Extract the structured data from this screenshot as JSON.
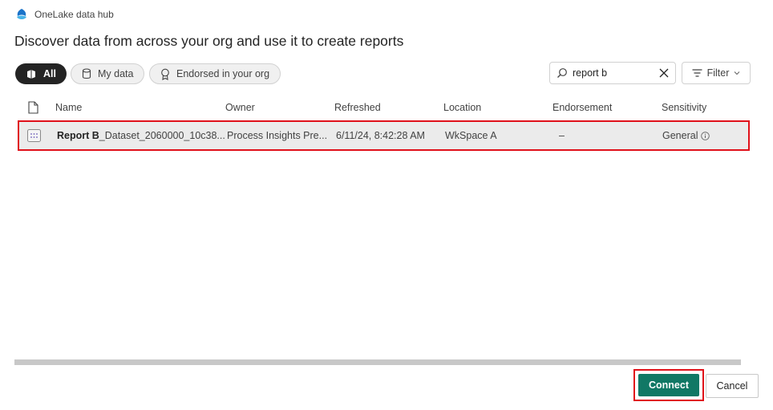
{
  "header": {
    "brand": "OneLake data hub",
    "title": "Discover data from across your org and use it to create reports"
  },
  "filters": {
    "pills": [
      {
        "label": "All",
        "icon": "cubes-icon",
        "selected": true
      },
      {
        "label": "My data",
        "icon": "database-icon",
        "selected": false
      },
      {
        "label": "Endorsed in your org",
        "icon": "ribbon-icon",
        "selected": false
      }
    ],
    "search_value": "report b",
    "filter_label": "Filter"
  },
  "table": {
    "columns": [
      "Name",
      "Owner",
      "Refreshed",
      "Location",
      "Endorsement",
      "Sensitivity"
    ],
    "rows": [
      {
        "name_bold": "Report B",
        "name_rest": "_Dataset_2060000_10c38...",
        "owner": "Process Insights Pre...",
        "refreshed": "6/11/24, 8:42:28 AM",
        "location": "WkSpace A",
        "endorsement": "–",
        "sensitivity": "General",
        "selected": true
      }
    ]
  },
  "footer": {
    "connect_label": "Connect",
    "cancel_label": "Cancel"
  },
  "colors": {
    "accent": "#117865",
    "highlight_border": "#e0111a"
  }
}
